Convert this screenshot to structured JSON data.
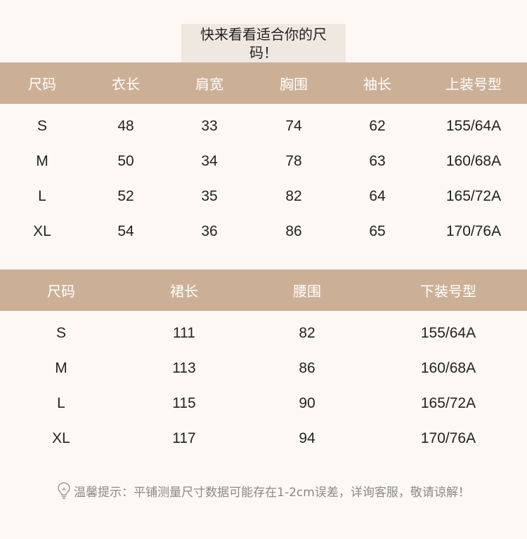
{
  "title": "快来看看适合你的尺码！",
  "top_table": {
    "headers": [
      "尺码",
      "衣长",
      "肩宽",
      "胸围",
      "袖长",
      "上装号型"
    ],
    "rows": [
      [
        "S",
        "48",
        "33",
        "74",
        "62",
        "155/64A"
      ],
      [
        "M",
        "50",
        "34",
        "78",
        "63",
        "160/68A"
      ],
      [
        "L",
        "52",
        "35",
        "82",
        "64",
        "165/72A"
      ],
      [
        "XL",
        "54",
        "36",
        "86",
        "65",
        "170/76A"
      ]
    ]
  },
  "bottom_table": {
    "headers": [
      "尺码",
      "裙长",
      "腰围",
      "下装号型"
    ],
    "rows": [
      [
        "S",
        "111",
        "82",
        "155/64A"
      ],
      [
        "M",
        "113",
        "86",
        "160/68A"
      ],
      [
        "L",
        "115",
        "90",
        "165/72A"
      ],
      [
        "XL",
        "117",
        "94",
        "170/76A"
      ]
    ]
  },
  "note": {
    "icon": "lightbulb-icon",
    "text": "温馨提示：平铺测量尺寸数据可能存在1-2cm误差，详询客服，敬请谅解！"
  },
  "colors": {
    "header_bg": "#ccb096",
    "page_bg": "#fdf8f3",
    "title_bg": "#efe8e1"
  }
}
